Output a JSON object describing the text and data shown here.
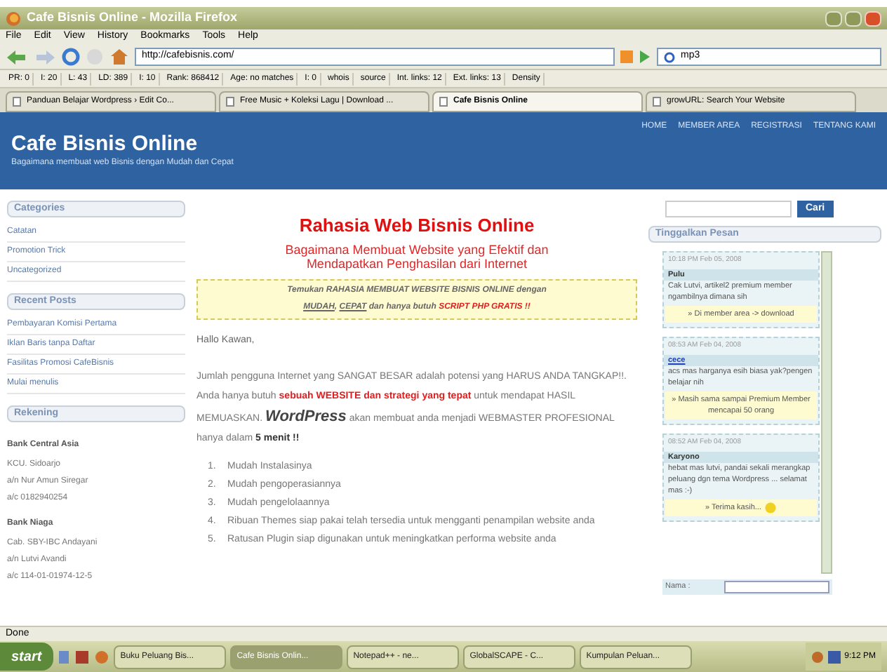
{
  "window": {
    "title": "Cafe Bisnis Online - Mozilla Firefox"
  },
  "menu": [
    "File",
    "Edit",
    "View",
    "History",
    "Bookmarks",
    "Tools",
    "Help"
  ],
  "address": {
    "value": "http://cafebisnis.com/"
  },
  "search": {
    "value": "mp3"
  },
  "seo_toolbar": [
    "PR: 0",
    "I: 20",
    "L: 43",
    "LD: 389",
    "I: 10",
    "Rank: 868412",
    "Age: no matches",
    "I: 0",
    "whois",
    "source",
    "Int. links: 12",
    "Ext. links: 13",
    "Density"
  ],
  "tabs": [
    {
      "label": "Panduan Belajar Wordpress › Edit Co...",
      "selected": false
    },
    {
      "label": "Free Music + Koleksi Lagu | Download ...",
      "selected": false
    },
    {
      "label": "Cafe Bisnis Online",
      "selected": true
    },
    {
      "label": "growURL: Search Your Website",
      "selected": false
    }
  ],
  "site": {
    "title": "Cafe Bisnis Online",
    "tagline": "Bagaimana membuat web Bisnis dengan Mudah dan Cepat",
    "nav": [
      "HOME",
      "MEMBER AREA",
      "REGISTRASI",
      "TENTANG KAMI"
    ]
  },
  "sidebar": {
    "sections": [
      {
        "title": "Categories",
        "links": [
          "Catatan",
          "Promotion Trick",
          "Uncategorized"
        ]
      },
      {
        "title": "Recent Posts",
        "links": [
          "Pembayaran Komisi Pertama",
          "Iklan Baris tanpa Daftar",
          "Fasilitas Promosi CafeBisnis",
          "Mulai menulis"
        ]
      },
      {
        "title": "Rekening",
        "banks": [
          {
            "name": "Bank Central Asia",
            "lines": [
              "KCU. Sidoarjo",
              "a/n Nur Amun Siregar",
              "a/c 0182940254"
            ]
          },
          {
            "name": "Bank Niaga",
            "lines": [
              "Cab. SBY-IBC Andayani",
              "a/n Lutvi Avandi",
              "a/c 114-01-01974-12-5"
            ]
          }
        ]
      }
    ]
  },
  "main": {
    "headline": "Rahasia Web Bisnis Online",
    "subheadline": "Bagaimana Membuat Website yang Efektif dan Mendapatkan Penghasilan dari Internet",
    "banner_lines": [
      [
        {
          "kind": "plain",
          "text": "Temukan RAHASIA MEMBUAT WEBSITE BISNIS ONLINE dengan"
        }
      ],
      [
        {
          "kind": "underline",
          "text": "MUDAH"
        },
        {
          "kind": "plain",
          "text": ", "
        },
        {
          "kind": "underline",
          "text": "CEPAT"
        },
        {
          "kind": "plain",
          "text": " dan hanya butuh "
        },
        {
          "kind": "red",
          "text": "SCRIPT PHP GRATIS !!"
        }
      ]
    ],
    "greeting": "Hallo Kawan,",
    "paragraph": [
      {
        "kind": "plain",
        "text": "Jumlah pengguna Internet yang SANGAT BESAR adalah potensi yang HARUS ANDA TANGKAP!!. Anda hanya butuh "
      },
      {
        "kind": "red",
        "text": "sebuah WEBSITE dan strategi yang tepat"
      },
      {
        "kind": "plain",
        "text": " untuk mendapat HASIL MEMUASKAN. "
      },
      {
        "kind": "brand",
        "text": "WordPress"
      },
      {
        "kind": "plain",
        "text": " akan membuat anda menjadi WEBMASTER PROFESIONAL hanya dalam "
      },
      {
        "kind": "bold",
        "text": "5 menit !!"
      }
    ],
    "list": [
      {
        "number": "1.",
        "text": "Mudah Instalasinya"
      },
      {
        "number": "2.",
        "text": "Mudah pengoperasiannya"
      },
      {
        "number": "3.",
        "text": "Mudah pengelolaannya"
      },
      {
        "number": "4.",
        "text": "Ribuan Themes siap pakai telah tersedia untuk mengganti penampilan website anda"
      },
      {
        "number": "5.",
        "text": "Ratusan Plugin siap digunakan untuk meningkatkan performa website anda"
      }
    ]
  },
  "right": {
    "search_button": "Cari",
    "shout_title": "Tinggalkan Pesan",
    "messages": [
      {
        "time": "10:18 PM Feb 05, 2008",
        "name": "Pulu",
        "link": false,
        "text": "Cak Lutvi, artikel2 premium member ngambilnya dimana sih",
        "reply": "» Di member area -> download",
        "smiley": false
      },
      {
        "time": "08:53 AM Feb 04, 2008",
        "name": "cece",
        "link": true,
        "text": "acs mas harganya esih biasa yak?pengen belajar nih",
        "reply": "» Masih sama sampai Premium Member mencapai 50 orang",
        "smiley": false
      },
      {
        "time": "08:52 AM Feb 04, 2008",
        "name": "Karyono",
        "link": false,
        "text": "hebat mas lutvi, pandai sekali merangkap peluang dgn tema Wordpress ... selamat mas :-)",
        "reply": "» Terima kasih...",
        "smiley": true
      }
    ],
    "name_label": "Nama :"
  },
  "status_bar": "Done",
  "taskbar": {
    "start": "start",
    "items": [
      {
        "label": "Buku Peluang Bis...",
        "selected": false
      },
      {
        "label": "Cafe Bisnis Onlin...",
        "selected": true
      },
      {
        "label": "Notepad++ - ne...",
        "selected": false
      },
      {
        "label": "GlobalSCAPE - C...",
        "selected": false
      },
      {
        "label": "Kumpulan Peluan...",
        "selected": false
      }
    ],
    "clock": "9:12 PM"
  }
}
